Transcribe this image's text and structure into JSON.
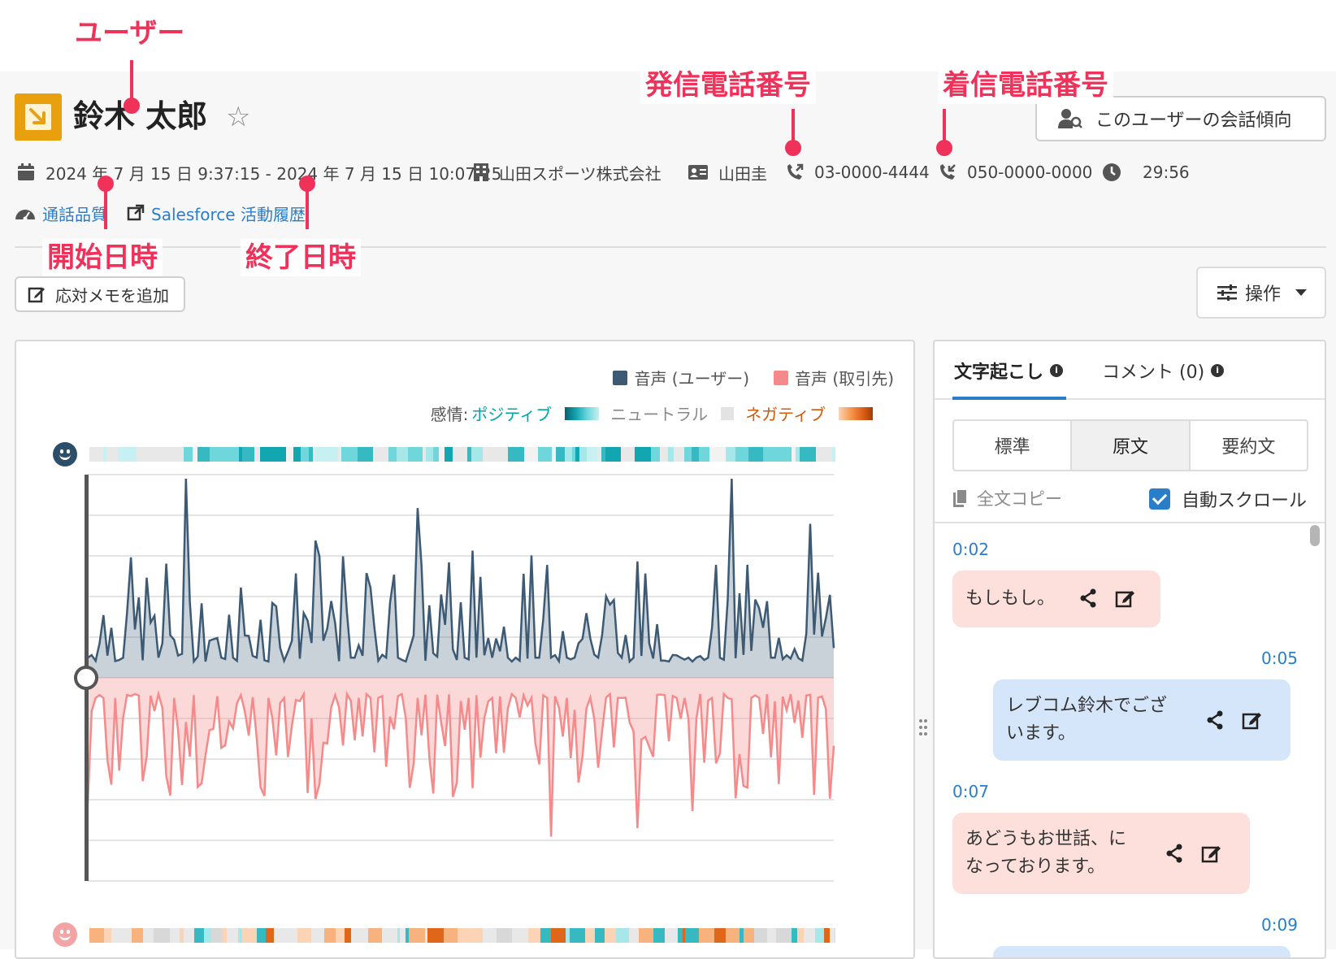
{
  "annotations": {
    "user": "ユーザー",
    "caller_number": "発信電話番号",
    "callee_number": "着信電話番号",
    "start_datetime": "開始日時",
    "end_datetime": "終了日時"
  },
  "header": {
    "user_name": "鈴木 太郎",
    "trend_button": "このユーザーの会話傾向"
  },
  "meta": {
    "datetime_range": "2024 年 7 月 15 日 9:37:15 - 2024 年 7 月 15 日 10:07:25",
    "company": "山田スポーツ株式会社",
    "contact": "山田圭",
    "caller_number": "03-0000-4444",
    "callee_number": "050-0000-0000",
    "duration": "29:56"
  },
  "links": {
    "call_quality": "通話品質",
    "salesforce": "Salesforce 活動履歴"
  },
  "actions": {
    "add_memo": "応対メモを追加",
    "operations": "操作"
  },
  "chart": {
    "legend_user": "音声 (ユーザー)",
    "legend_client": "音声 (取引先)",
    "sentiment_label": "感情:",
    "positive": "ポジティブ",
    "neutral": "ニュートラル",
    "negative": "ネガティブ",
    "colors": {
      "user": "#3d5a75",
      "client": "#f68a8a",
      "positive": "#00a5a8",
      "negative": "#d25a0a"
    }
  },
  "transcript": {
    "tab_transcript": "文字起こし",
    "tab_comments": "コメント (0)",
    "modes": [
      "標準",
      "原文",
      "要約文"
    ],
    "active_mode": "原文",
    "copy_all": "全文コピー",
    "auto_scroll": "自動スクロール",
    "messages": [
      {
        "time": "0:02",
        "text": "もしもし。",
        "speaker": "client"
      },
      {
        "time": "0:05",
        "text_line1": "レブコム鈴木でござ",
        "text_line2": "います。",
        "speaker": "user"
      },
      {
        "time": "0:07",
        "text_line1": "あどうもお世話、に",
        "text_line2": "なっております。",
        "speaker": "client"
      },
      {
        "time": "0:09",
        "speaker": "user"
      }
    ]
  }
}
